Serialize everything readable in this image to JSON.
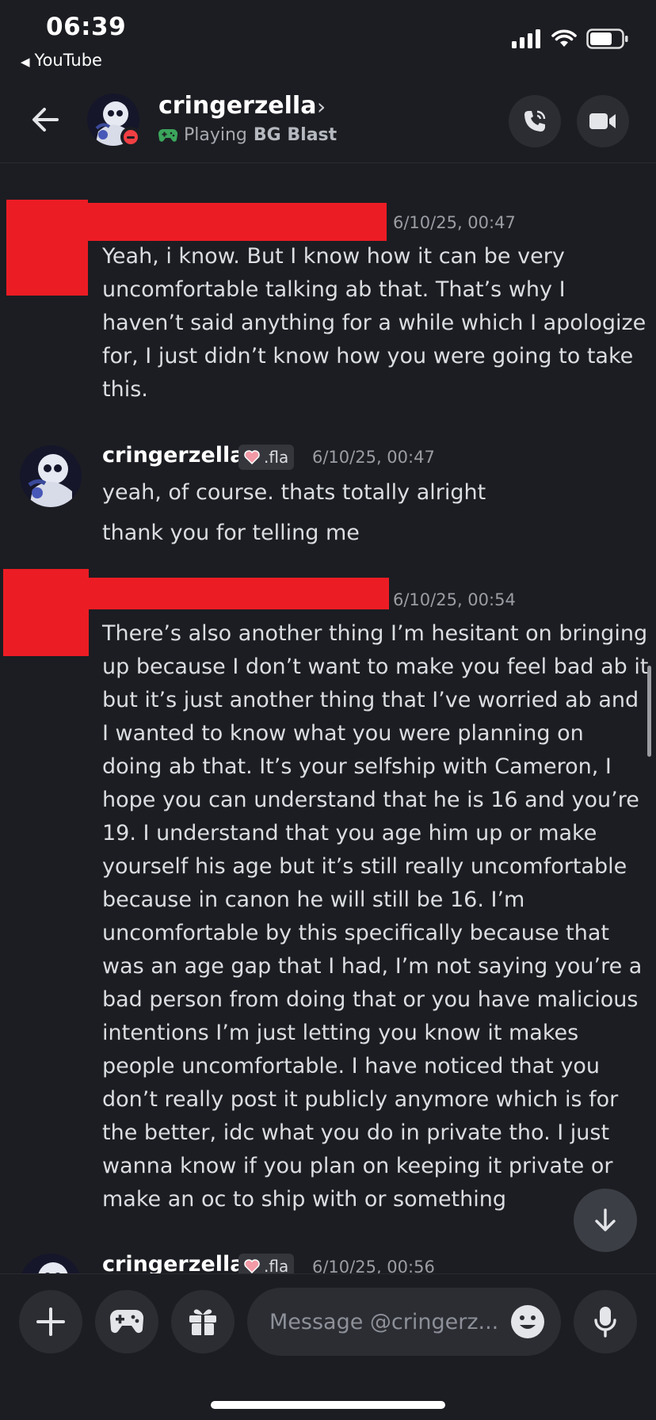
{
  "status_bar": {
    "time": "06:39",
    "back_app": "YouTube",
    "back_arrow_icon": "triangle-left-icon"
  },
  "header": {
    "name": "cringerzella",
    "activity_prefix": "Playing",
    "activity_game": "BG Blast",
    "status": "do-not-disturb",
    "status_color": "#f23f43"
  },
  "messages": [
    {
      "author_redacted": true,
      "timestamp": "6/10/25, 00:47",
      "text": "Yeah, i know. But I know how it can be very uncomfortable talking ab that. That’s why I haven’t said anything for a while which I apologize for, I just didn’t know how you were going to take this."
    },
    {
      "author": "cringerzella",
      "tag": ".fla",
      "timestamp": "6/10/25, 00:47",
      "lines": [
        "yeah, of course. thats totally alright",
        "thank you for telling me"
      ]
    },
    {
      "author_redacted": true,
      "timestamp": "6/10/25, 00:54",
      "text": "There’s also another thing I’m hesitant on bringing up because I don’t want to make you feel bad ab it but it’s just another thing that I’ve worried ab and I wanted to know what you were planning on doing ab that. It’s your selfship with Cameron, I hope you can understand that he is 16 and you’re 19. I understand that you age him up or make yourself his age but it’s still really uncomfortable because in canon he will still be 16. I’m uncomfortable by this specifically because that was an age gap that I had, I’m not saying you’re a bad person from doing that  or you have malicious intentions I’m just letting you know it makes people uncomfortable. I have noticed that you don’t really post it publicly anymore which is for the better, idc what you do in private tho. I just wanna know if you plan on keeping it private or make an oc to ship with or something"
    },
    {
      "author": "cringerzella",
      "tag": ".fla",
      "timestamp": "6/10/25, 00:56"
    }
  ],
  "composer": {
    "placeholder": "Message @cringerz..."
  },
  "colors": {
    "background": "#1c1d22",
    "redaction": "#ec1c24",
    "surface": "#2b2d33"
  }
}
